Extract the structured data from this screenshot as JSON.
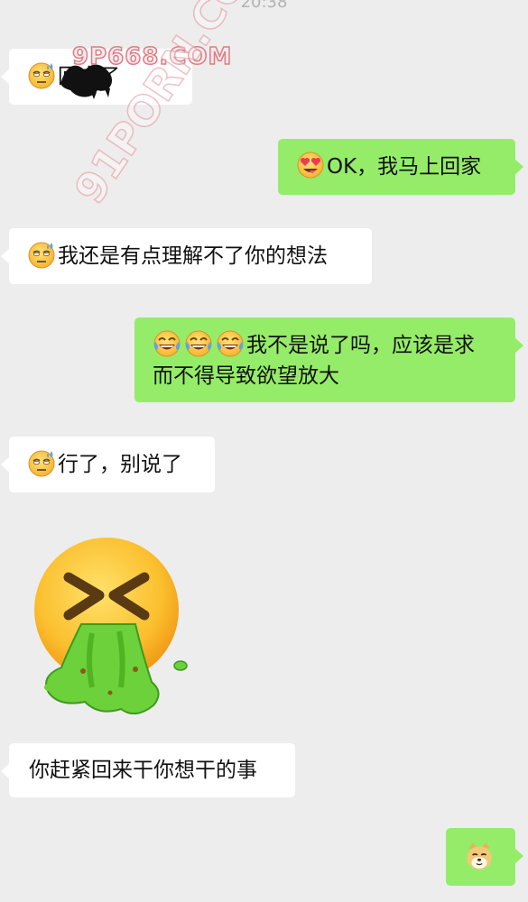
{
  "status_bar": {
    "time": "20:38"
  },
  "messages": [
    {
      "side": "in",
      "emoji": "sweat-face-icon",
      "text": "回去了"
    },
    {
      "side": "out",
      "emoji": "heart-eyes-icon",
      "text": "OK，我马上回家"
    },
    {
      "side": "in",
      "emoji": "sweat-face-icon",
      "text": "我还是有点理解不了你的想法"
    },
    {
      "side": "out",
      "emoji": "tears-of-joy-icon",
      "line1": "我不是说了吗，应该是求",
      "line2": "而不得导致欲望放大"
    },
    {
      "side": "in",
      "emoji": "sweat-face-icon",
      "text": "行了，别说了"
    },
    {
      "side": "in",
      "sticker": "vomiting-face-sticker"
    },
    {
      "side": "in",
      "text": "你赶紧回来干你想干的事"
    },
    {
      "side": "out",
      "emoji": "doge-icon"
    }
  ],
  "watermarks": {
    "top": "9P668.COM",
    "diagonal": "91PORN.COM"
  },
  "colors": {
    "background": "#ededed",
    "incoming": "#ffffff",
    "outgoing": "#95ec69"
  }
}
